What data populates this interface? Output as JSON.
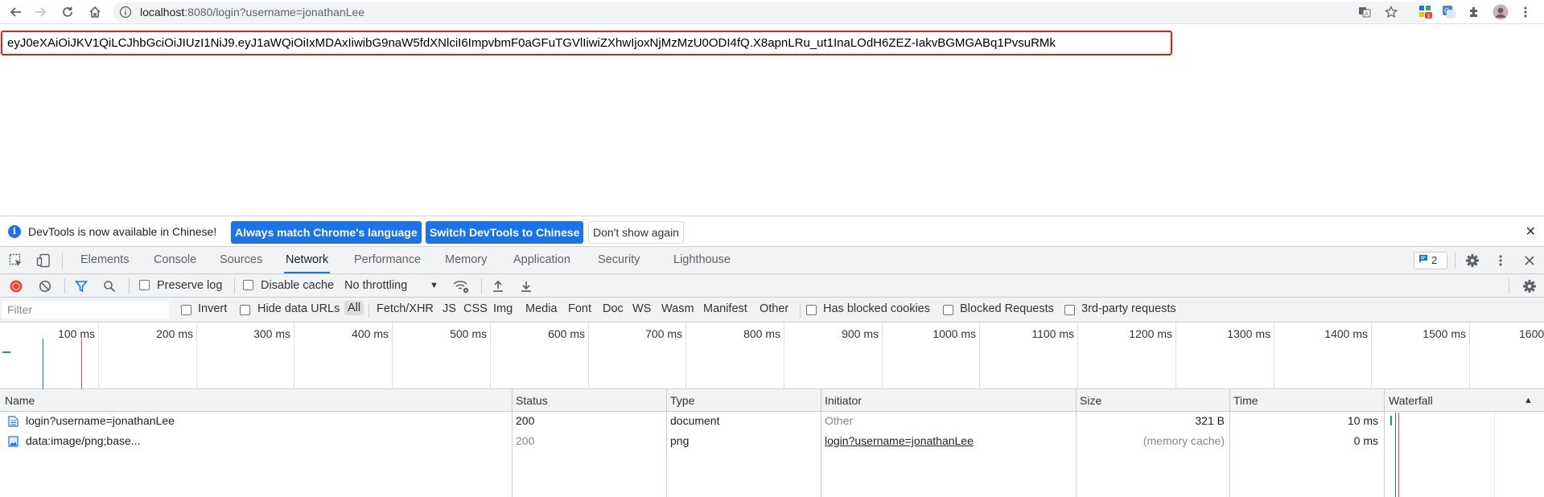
{
  "browser": {
    "url_host": "localhost",
    "url_rest": ":8080/login?username=jonathanLee",
    "extension_badge": "1"
  },
  "page": {
    "jwt_token": "eyJ0eXAiOiJKV1QiLCJhbGciOiJIUzI1NiJ9.eyJ1aWQiOiIxMDAxIiwibG9naW5fdXNlciI6ImpvbmF0aGFuTGVlIiwiZXhwIjoxNjMzMzU0ODI4fQ.X8apnLRu_ut1InaLOdH6ZEZ-IakvBGMGABq1PvsuRMk"
  },
  "infobar": {
    "message": "DevTools is now available in Chinese!",
    "btn_match": "Always match Chrome's language",
    "btn_switch": "Switch DevTools to Chinese",
    "btn_dont_show": "Don't show again"
  },
  "devtools": {
    "tabs": [
      "Elements",
      "Console",
      "Sources",
      "Network",
      "Performance",
      "Memory",
      "Application",
      "Security",
      "Lighthouse"
    ],
    "active_tab": "Network",
    "message_count": "2"
  },
  "network_toolbar": {
    "preserve_log": "Preserve log",
    "disable_cache": "Disable cache",
    "throttling": "No throttling"
  },
  "filter_bar": {
    "placeholder": "Filter",
    "invert": "Invert",
    "hide_data_urls": "Hide data URLs",
    "types": [
      "All",
      "Fetch/XHR",
      "JS",
      "CSS",
      "Img",
      "Media",
      "Font",
      "Doc",
      "WS",
      "Wasm",
      "Manifest",
      "Other"
    ],
    "has_blocked_cookies": "Has blocked cookies",
    "blocked_requests": "Blocked Requests",
    "third_party": "3rd-party requests"
  },
  "overview": {
    "ticks": [
      "100 ms",
      "200 ms",
      "300 ms",
      "400 ms",
      "500 ms",
      "600 ms",
      "700 ms",
      "800 ms",
      "900 ms",
      "1000 ms",
      "1100 ms",
      "1200 ms",
      "1300 ms",
      "1400 ms",
      "1500 ms",
      "1600"
    ]
  },
  "table": {
    "columns": [
      "Name",
      "Status",
      "Type",
      "Initiator",
      "Size",
      "Time",
      "Waterfall"
    ],
    "rows": [
      {
        "name": "login?username=jonathanLee",
        "status": "200",
        "type": "document",
        "initiator": "Other",
        "size": "321 B",
        "time": "10 ms"
      },
      {
        "name": "data:image/png;base...",
        "status": "200",
        "type": "png",
        "initiator": "login?username=jonathanLee",
        "size": "(memory cache)",
        "time": "0 ms"
      }
    ]
  },
  "colors": {
    "accent": "#1a73e8",
    "highlight_border": "#e2231a",
    "record": "#e8453c"
  }
}
